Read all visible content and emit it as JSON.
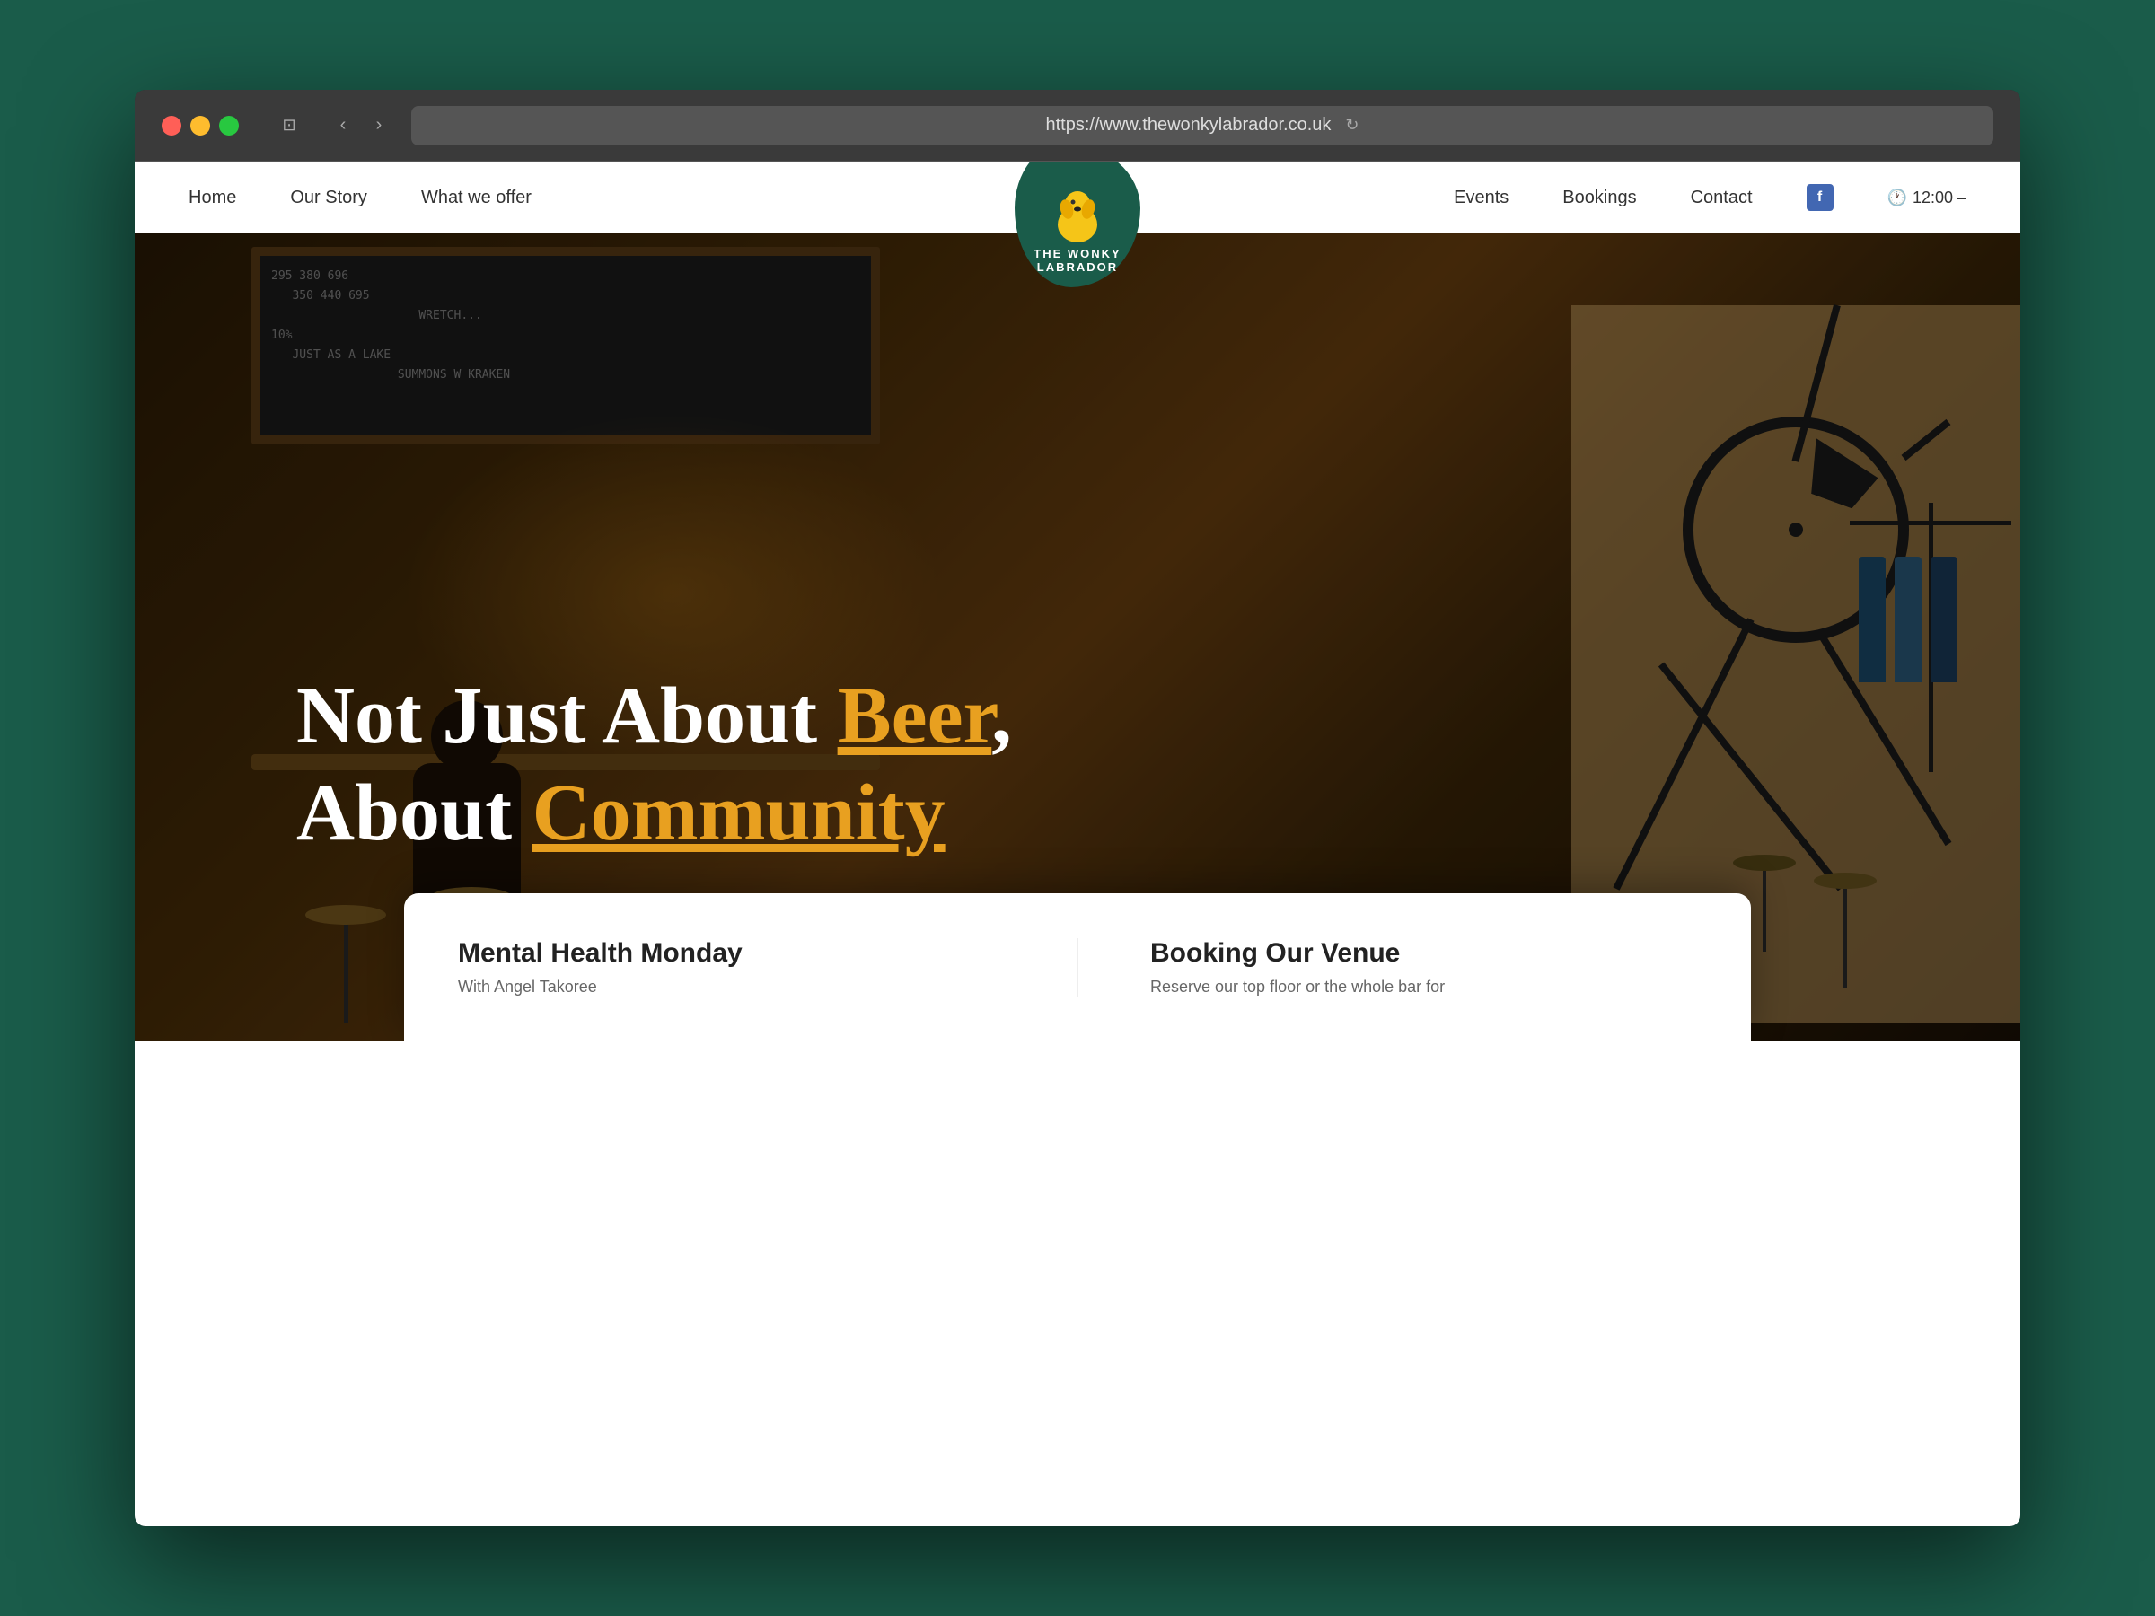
{
  "browser": {
    "url": "https://www.thewonkylabrador.co.uk",
    "back_icon": "‹",
    "forward_icon": "›",
    "sidebar_icon": "⊡",
    "refresh_icon": "↻"
  },
  "nav": {
    "links": [
      {
        "label": "Home",
        "id": "home"
      },
      {
        "label": "Our Story",
        "id": "our-story"
      },
      {
        "label": "What we offer",
        "id": "what-we-offer"
      },
      {
        "label": "Events",
        "id": "events"
      },
      {
        "label": "Bookings",
        "id": "bookings"
      },
      {
        "label": "Contact",
        "id": "contact"
      }
    ],
    "logo_line1": "THE WONKY",
    "logo_line2": "LABRADOR",
    "hours": "12:00 –",
    "facebook_label": "f"
  },
  "hero": {
    "headline_part1": "Not Just About ",
    "headline_beer": "Beer",
    "headline_comma": ",",
    "headline_part2": "About ",
    "headline_community": "Community"
  },
  "cards": [
    {
      "title": "Mental Health Monday",
      "subtitle": "With Angel Takoree"
    },
    {
      "title": "Booking Our Venue",
      "subtitle": "Reserve our top floor or the whole bar for"
    }
  ]
}
